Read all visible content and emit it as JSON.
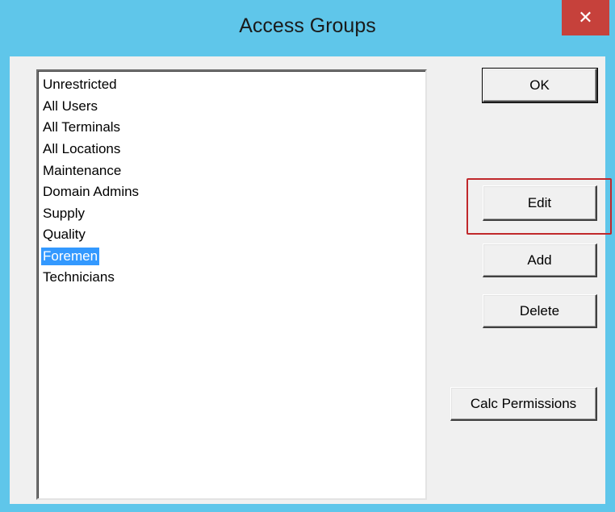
{
  "window": {
    "title": "Access Groups",
    "close_icon": "close-icon",
    "colors": {
      "titlebar": "#5fc6ea",
      "close": "#c6413b",
      "selection": "#3399ff",
      "highlight": "#c0282b"
    }
  },
  "list": {
    "items": [
      "Unrestricted",
      "All Users",
      "All Terminals",
      "All Locations",
      "Maintenance",
      "Domain Admins",
      "Supply",
      "Quality",
      "Foremen",
      "Technicians"
    ],
    "selected": "Foremen"
  },
  "buttons": {
    "ok": "OK",
    "edit": "Edit",
    "add": "Add",
    "delete": "Delete",
    "calc": "Calc Permissions"
  }
}
